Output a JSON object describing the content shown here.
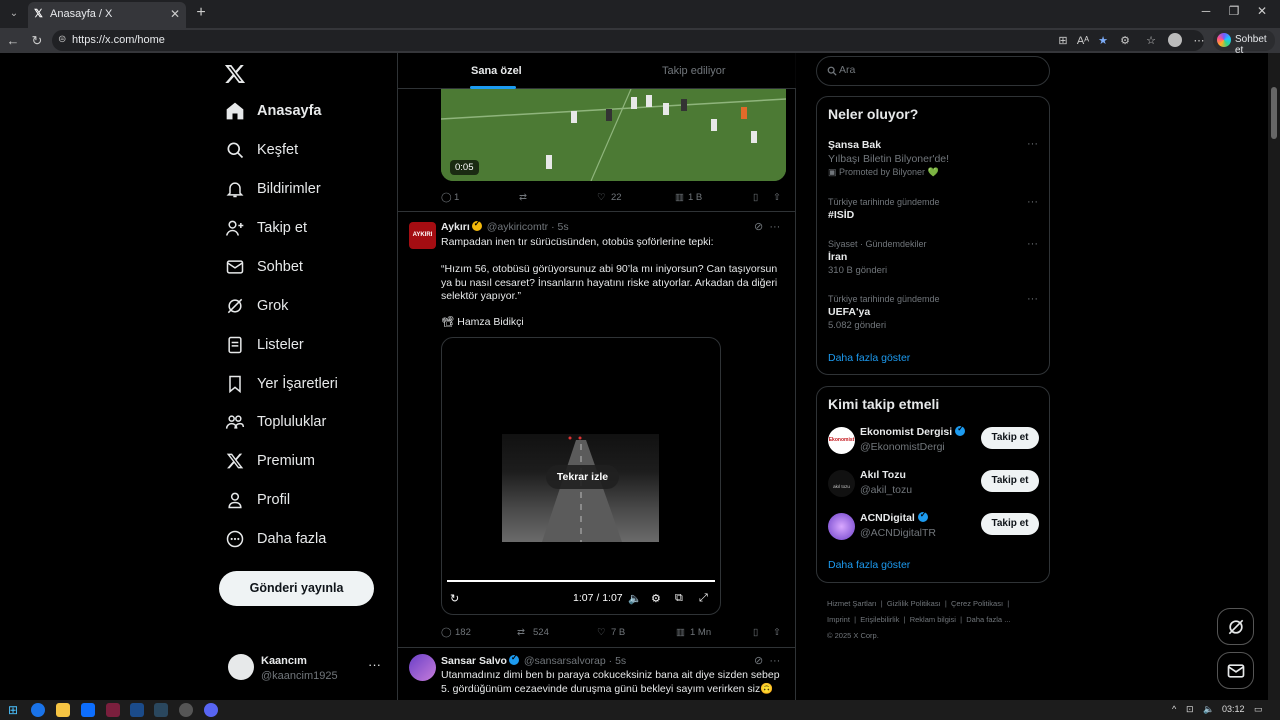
{
  "browser": {
    "tab_title": "Anasayfa / X",
    "tab_favicon": "𝕏",
    "url": "https://x.com/home",
    "copilot_label": "Sohbet et"
  },
  "nav": {
    "items": [
      {
        "label": "Anasayfa",
        "icon": "home-icon"
      },
      {
        "label": "Keşfet",
        "icon": "search-icon"
      },
      {
        "label": "Bildirimler",
        "icon": "bell-icon"
      },
      {
        "label": "Takip et",
        "icon": "add-user-icon"
      },
      {
        "label": "Sohbet",
        "icon": "mail-icon"
      },
      {
        "label": "Grok",
        "icon": "grok-icon"
      },
      {
        "label": "Listeler",
        "icon": "list-icon"
      },
      {
        "label": "Yer İşaretleri",
        "icon": "bookmark-icon"
      },
      {
        "label": "Topluluklar",
        "icon": "communities-icon"
      },
      {
        "label": "Premium",
        "icon": "x-logo-icon"
      },
      {
        "label": "Profil",
        "icon": "profile-icon"
      },
      {
        "label": "Daha fazla",
        "icon": "more-circle-icon"
      }
    ],
    "post_button": "Gönderi yayınla",
    "account": {
      "name": "Kaancım",
      "handle": "@kaancim1925"
    }
  },
  "timeline": {
    "tabs": [
      "Sana özel",
      "Takip ediliyor"
    ],
    "tweet1": {
      "video_time": "0:05",
      "replies": "1",
      "retweets": "",
      "likes": "22",
      "views": "1 B"
    },
    "tweet2": {
      "name": "Aykırı",
      "handle": "@aykiricomtr",
      "time": "· 5s",
      "avatar_text": "AYKIRI",
      "line1": "Rampadan inen tır sürücüsünden, otobüs şoförlerine tepki:",
      "quote": "“Hızım 56, otobüsü görüyorsunuz abi 90’la mı iniyorsun? Can taşıyorsun ya bu nasıl cesaret? İnsanların hayatını riske atıyorlar. Arkadan da diğeri selektör yapıyor.”",
      "credit": "📽 Hamza Bidikçi",
      "replay": "Tekrar izle",
      "video_time": "1:07 / 1:07",
      "replies": "182",
      "retweets": "524",
      "likes": "7 B",
      "views": "1 Mn"
    },
    "tweet3": {
      "name": "Sansar Salvo",
      "handle": "@sansarsalvorap",
      "time": "· 5s",
      "text": "Utanmadınız dimi ben bı paraya cokuceksiniz bana ait diye sizden sebep 5. gördüğünüm cezaevinde duruşma günü bekleyi sayım verirken siz🙃"
    }
  },
  "right": {
    "search_placeholder": "Ara",
    "trends_title": "Neler oluyor?",
    "promo": {
      "title": "Şansa Bak",
      "subtitle": "Yılbaşı Biletin Bilyoner'de!",
      "promoted": "Promoted by Bilyoner 💚"
    },
    "trends": [
      {
        "context": "Türkiye tarihinde gündemde",
        "title": "#ISİD",
        "count": ""
      },
      {
        "context": "Siyaset · Gündemdekiler",
        "title": "İran",
        "count": "310 B gönderi"
      },
      {
        "context": "Türkiye tarihinde gündemde",
        "title": "UEFA'ya",
        "count": "5.082 gönderi"
      }
    ],
    "show_more": "Daha fazla göster",
    "wtf_title": "Kimi takip etmeli",
    "who_to_follow": [
      {
        "name": "Ekonomist Dergisi",
        "handle": "@EkonomistDergi",
        "verified": true,
        "avatar_text": "Ekonomist"
      },
      {
        "name": "Akıl Tozu",
        "handle": "@akil_tozu",
        "verified": false,
        "avatar_text": "akıl tozu"
      },
      {
        "name": "ACNDigital",
        "handle": "@ACNDigitalTR",
        "verified": true,
        "avatar_text": ""
      }
    ],
    "follow_label": "Takip et",
    "footer": [
      "Hizmet Şartları",
      "Gizlilik Politikası",
      "Çerez Politikası",
      "Imprint",
      "Erişilebilirlik",
      "Reklam bilgisi",
      "Daha fazla ...",
      "© 2025 X Corp."
    ]
  },
  "taskbar": {
    "clock": "03:12"
  },
  "colors": {
    "accent": "#1d9bf0",
    "background": "#000000",
    "border": "#2f3336",
    "muted": "#71767b",
    "verified_gold": "#f4b90b"
  }
}
